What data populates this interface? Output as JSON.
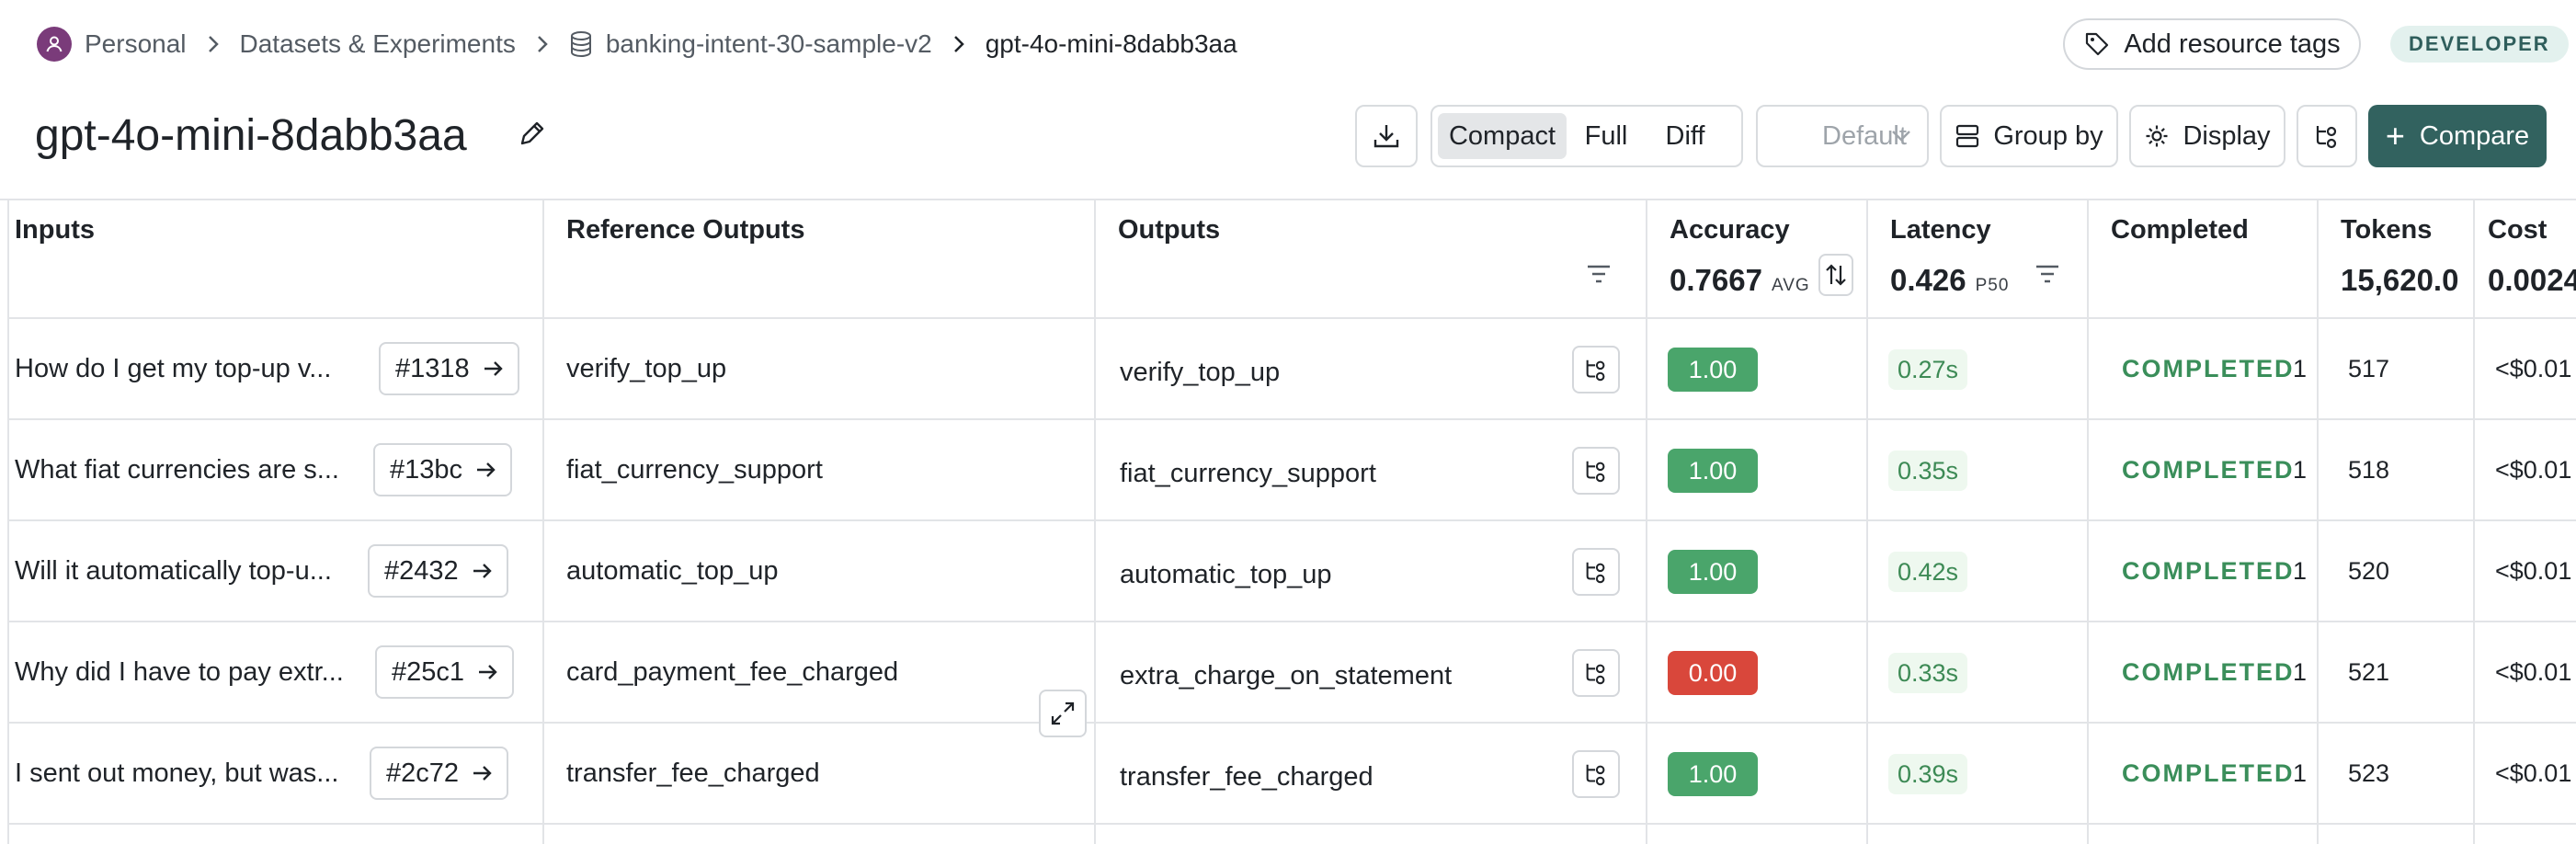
{
  "breadcrumb": {
    "workspace": "Personal",
    "section": "Datasets & Experiments",
    "dataset": "banking-intent-30-sample-v2",
    "experiment": "gpt-4o-mini-8dabb3aa"
  },
  "header": {
    "add_tags_label": "Add resource tags",
    "role_badge": "DEVELOPER",
    "title": "gpt-4o-mini-8dabb3aa"
  },
  "toolbar": {
    "view_modes": [
      "Compact",
      "Full",
      "Diff"
    ],
    "active_view": "Compact",
    "default_select": "Default",
    "group_by_label": "Group by",
    "display_label": "Display",
    "compare_label": "Compare"
  },
  "columns": {
    "inputs": "Inputs",
    "reference_outputs": "Reference Outputs",
    "outputs": "Outputs",
    "accuracy": "Accuracy",
    "accuracy_value": "0.7667",
    "accuracy_stat": "AVG",
    "latency": "Latency",
    "latency_value": "0.426",
    "latency_stat": "P50",
    "completed": "Completed",
    "tokens": "Tokens",
    "tokens_value": "15,620.0",
    "cost": "Cost",
    "cost_value": "0.0024"
  },
  "rows": [
    {
      "input": "How do I get my top-up v...",
      "id": "#1318",
      "reference": "verify_top_up",
      "output": "verify_top_up",
      "accuracy": "1.00",
      "latency": "0.27s",
      "status": "COMPLETED",
      "count": "1",
      "tokens": "517",
      "cost": "<$0.01"
    },
    {
      "input": "What fiat currencies are s...",
      "id": "#13bc",
      "reference": "fiat_currency_support",
      "output": "fiat_currency_support",
      "accuracy": "1.00",
      "latency": "0.35s",
      "status": "COMPLETED",
      "count": "1",
      "tokens": "518",
      "cost": "<$0.01"
    },
    {
      "input": "Will it automatically top-u...",
      "id": "#2432",
      "reference": "automatic_top_up",
      "output": "automatic_top_up",
      "accuracy": "1.00",
      "latency": "0.42s",
      "status": "COMPLETED",
      "count": "1",
      "tokens": "520",
      "cost": "<$0.01"
    },
    {
      "input": "Why did I have to pay extr...",
      "id": "#25c1",
      "reference": "card_payment_fee_charged",
      "output": "extra_charge_on_statement",
      "accuracy": "0.00",
      "latency": "0.33s",
      "status": "COMPLETED",
      "count": "1",
      "tokens": "521",
      "cost": "<$0.01"
    },
    {
      "input": "I sent out money, but was...",
      "id": "#2c72",
      "reference": "transfer_fee_charged",
      "output": "transfer_fee_charged",
      "accuracy": "1.00",
      "latency": "0.39s",
      "status": "COMPLETED",
      "count": "1",
      "tokens": "523",
      "cost": "<$0.01"
    }
  ],
  "colors": {
    "pass": "#4aa56b",
    "fail": "#d9473b",
    "primary": "#32625f"
  }
}
